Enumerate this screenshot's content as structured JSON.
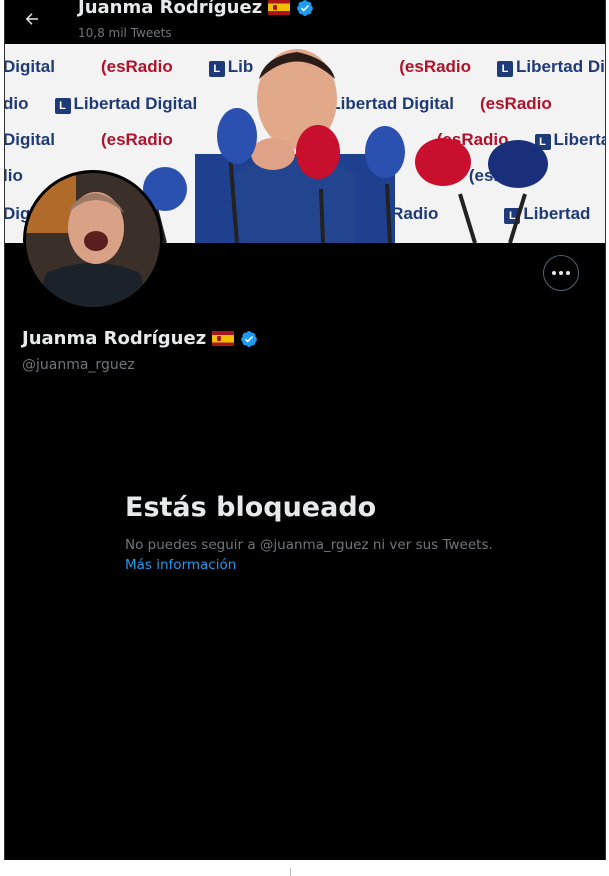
{
  "header": {
    "name": "Juanma Rodríguez",
    "tweet_count": "10,8 mil Tweets"
  },
  "banner": {
    "logos": {
      "es_radio": "(esRadio",
      "libertad_digital": "Libertad Digital",
      "digital": "Digital",
      "lio": "lio",
      "dio": "dio"
    }
  },
  "profile": {
    "name": "Juanma Rodríguez",
    "handle": "@juanma_rguez"
  },
  "blocked": {
    "title": "Estás bloqueado",
    "description": "No puedes seguir a @juanma_rguez ni ver sus Tweets.",
    "more_info": "Más información"
  },
  "icons": [
    "back-arrow-icon",
    "spain-flag-icon",
    "verified-badge-icon",
    "more-dots-icon"
  ],
  "colors": {
    "background": "#000000",
    "text_primary": "#e7e9ea",
    "text_secondary": "#71767b",
    "link": "#1d9bf0",
    "verified": "#1d9bf0"
  }
}
